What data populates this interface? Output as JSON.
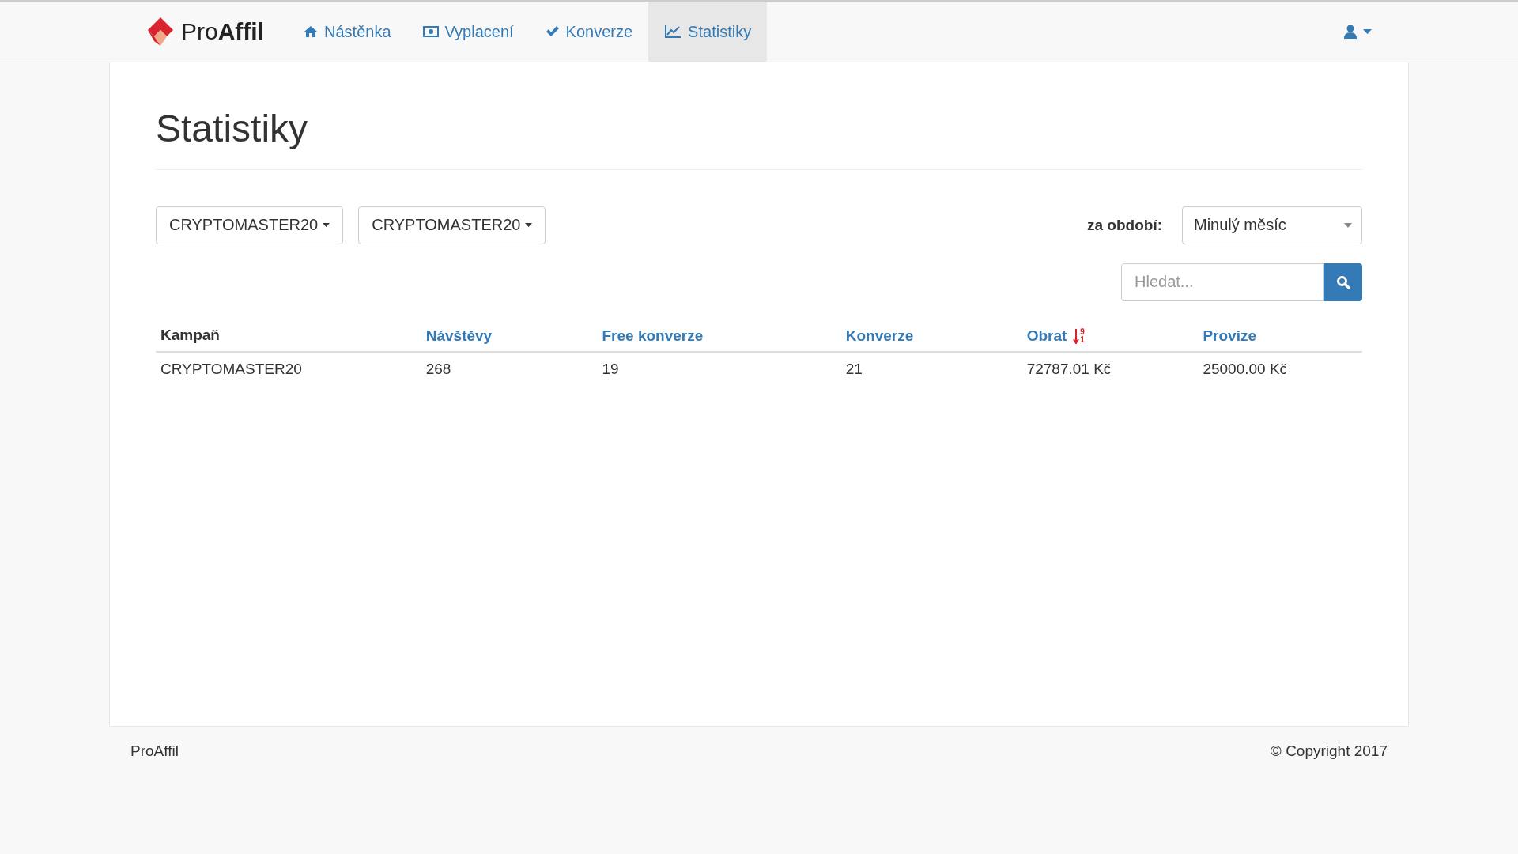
{
  "navbar": {
    "brand": {
      "prefix": "Pro",
      "suffix": "Affil"
    },
    "items": [
      {
        "kind": "home",
        "label": "Nástěnka",
        "selected": false
      },
      {
        "kind": "money",
        "label": "Vyplacení",
        "selected": false
      },
      {
        "kind": "check",
        "label": "Konverze",
        "selected": false
      },
      {
        "kind": "chart",
        "label": "Statistiky",
        "selected": true
      }
    ]
  },
  "page": {
    "title": "Statistiky",
    "filters": [
      "CRYPTOMASTER20",
      "CRYPTOMASTER20"
    ],
    "period": {
      "label": "za období:",
      "value": "Minulý měsíc"
    },
    "search": {
      "placeholder": "Hledat..."
    },
    "table": {
      "columns": [
        {
          "label": "Kampaň",
          "sortable": false,
          "sorted": false
        },
        {
          "label": "Návštěvy",
          "sortable": true,
          "sorted": false
        },
        {
          "label": "Free konverze",
          "sortable": true,
          "sorted": false
        },
        {
          "label": "Konverze",
          "sortable": true,
          "sorted": false
        },
        {
          "label": "Obrat",
          "sortable": true,
          "sorted": true,
          "sort_digits": [
            "9",
            "1"
          ]
        },
        {
          "label": "Provize",
          "sortable": true,
          "sorted": false
        }
      ],
      "rows": [
        [
          "CRYPTOMASTER20",
          "268",
          "19",
          "21",
          "72787.01 Kč",
          "25000.00 Kč"
        ]
      ]
    }
  },
  "footer": {
    "left": "ProAffil",
    "right": "© Copyright 2017"
  }
}
